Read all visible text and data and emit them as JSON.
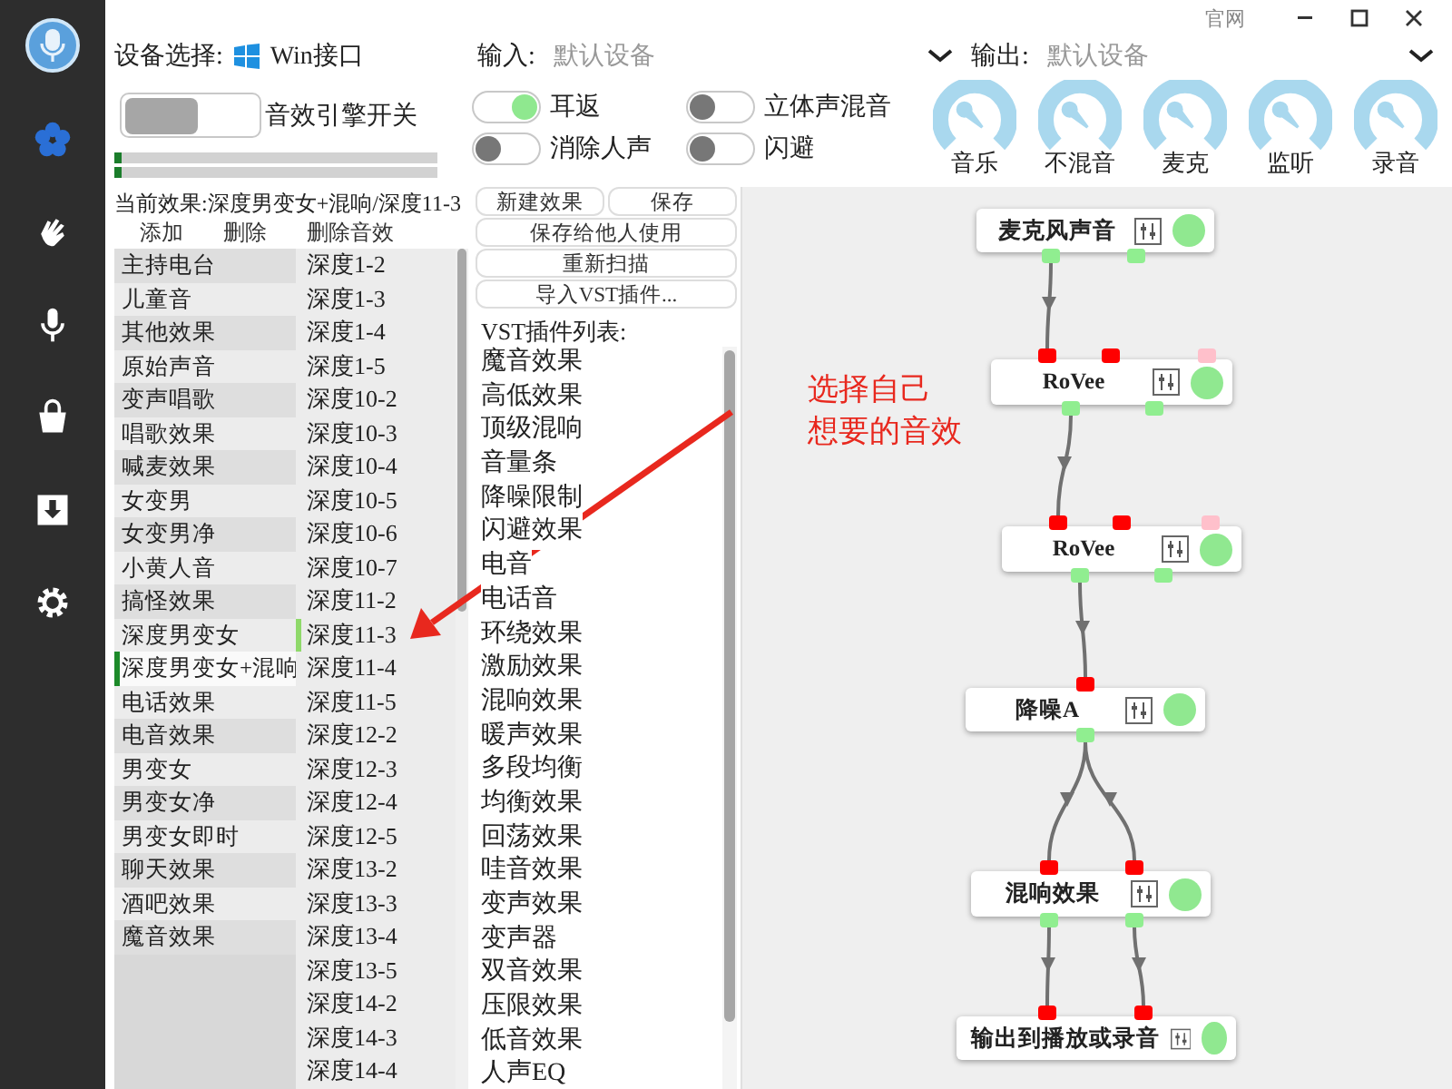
{
  "window": {
    "link": "官网"
  },
  "sidebar": {
    "items": [
      {
        "selected": true
      },
      {
        "selected": false
      },
      {
        "selected": false
      },
      {
        "selected": false
      },
      {
        "selected": false
      },
      {
        "selected": false
      }
    ]
  },
  "device": {
    "label": "设备选择:",
    "value": "Win接口"
  },
  "input": {
    "label": "输入:",
    "value": "默认设备"
  },
  "output": {
    "label": "输出:",
    "value": "默认设备"
  },
  "engine": {
    "label": "音效引擎开关",
    "on": false
  },
  "meters": [
    {
      "level": 0.02
    },
    {
      "level": 0.02
    }
  ],
  "switches": [
    {
      "label": "耳返",
      "on": true
    },
    {
      "label": "立体声混音",
      "on": false
    },
    {
      "label": "消除人声",
      "on": false
    },
    {
      "label": "闪避",
      "on": false
    }
  ],
  "knobs": [
    {
      "label": "音乐"
    },
    {
      "label": "不混音"
    },
    {
      "label": "麦克"
    },
    {
      "label": "监听"
    },
    {
      "label": "录音"
    }
  ],
  "current_effect": "当前效果:深度男变女+混响/深度11-3",
  "actions": [
    "添加",
    "删除",
    "删除音效"
  ],
  "presets": [
    {
      "label": "主持电台",
      "selected": false
    },
    {
      "label": "儿童音",
      "selected": false
    },
    {
      "label": "其他效果",
      "selected": false
    },
    {
      "label": "原始声音",
      "selected": false
    },
    {
      "label": "变声唱歌",
      "selected": false
    },
    {
      "label": "唱歌效果",
      "selected": false
    },
    {
      "label": "喊麦效果",
      "selected": false
    },
    {
      "label": "女变男",
      "selected": false
    },
    {
      "label": "女变男净",
      "selected": false
    },
    {
      "label": "小黄人音",
      "selected": false
    },
    {
      "label": "搞怪效果",
      "selected": false
    },
    {
      "label": "深度男变女",
      "selected": false
    },
    {
      "label": "深度男变女+混响",
      "selected": true
    },
    {
      "label": "电话效果",
      "selected": false
    },
    {
      "label": "电音效果",
      "selected": false
    },
    {
      "label": "男变女",
      "selected": false
    },
    {
      "label": "男变女净",
      "selected": false
    },
    {
      "label": "男变女即时",
      "selected": false
    },
    {
      "label": "聊天效果",
      "selected": false
    },
    {
      "label": "酒吧效果",
      "selected": false
    },
    {
      "label": "魔音效果",
      "selected": false
    }
  ],
  "variants": [
    {
      "label": "深度1-2",
      "selected": false
    },
    {
      "label": "深度1-3",
      "selected": false
    },
    {
      "label": "深度1-4",
      "selected": false
    },
    {
      "label": "深度1-5",
      "selected": false
    },
    {
      "label": "深度10-2",
      "selected": false
    },
    {
      "label": "深度10-3",
      "selected": false
    },
    {
      "label": "深度10-4",
      "selected": false
    },
    {
      "label": "深度10-5",
      "selected": false
    },
    {
      "label": "深度10-6",
      "selected": false
    },
    {
      "label": "深度10-7",
      "selected": false
    },
    {
      "label": "深度11-2",
      "selected": false
    },
    {
      "label": "深度11-3",
      "selected": true
    },
    {
      "label": "深度11-4",
      "selected": false
    },
    {
      "label": "深度11-5",
      "selected": false
    },
    {
      "label": "深度12-2",
      "selected": false
    },
    {
      "label": "深度12-3",
      "selected": false
    },
    {
      "label": "深度12-4",
      "selected": false
    },
    {
      "label": "深度12-5",
      "selected": false
    },
    {
      "label": "深度13-2",
      "selected": false
    },
    {
      "label": "深度13-3",
      "selected": false
    },
    {
      "label": "深度13-4",
      "selected": false
    },
    {
      "label": "深度13-5",
      "selected": false
    },
    {
      "label": "深度14-2",
      "selected": false
    },
    {
      "label": "深度14-3",
      "selected": false
    },
    {
      "label": "深度14-4",
      "selected": false
    }
  ],
  "buttons": [
    [
      "新建效果",
      "保存"
    ],
    [
      "保存给他人使用"
    ],
    [
      "重新扫描"
    ],
    [
      "导入VST插件..."
    ]
  ],
  "vst": {
    "title": "VST插件列表:",
    "items": [
      "魔音效果",
      "高低效果",
      "顶级混响",
      "音量条",
      "降噪限制",
      "闪避效果",
      "电音",
      "电话音",
      "环绕效果",
      "激励效果",
      "混响效果",
      "暖声效果",
      "多段均衡",
      "均衡效果",
      "回荡效果",
      "哇音效果",
      "变声效果",
      "变声器",
      "双音效果",
      "压限效果",
      "低音效果",
      "人声EQ"
    ]
  },
  "graph": {
    "nodes": [
      {
        "title": "麦克风声音",
        "enabled": true,
        "outputs": [
          {
            "color": "#90ee90"
          },
          {
            "color": "#90ee90"
          }
        ]
      },
      {
        "title": "RoVee",
        "enabled": true,
        "inputs": [
          {
            "color": "#ff0000"
          },
          {
            "color": "#ff0000"
          },
          {
            "color": "#ffc0cb"
          }
        ],
        "outputs": [
          {
            "color": "#90ee90"
          },
          {
            "color": "#90ee90"
          }
        ]
      },
      {
        "title": "RoVee",
        "enabled": true,
        "inputs": [
          {
            "color": "#ff0000"
          },
          {
            "color": "#ff0000"
          },
          {
            "color": "#ffc0cb"
          }
        ],
        "outputs": [
          {
            "color": "#90ee90"
          },
          {
            "color": "#90ee90"
          }
        ]
      },
      {
        "title": "降噪A",
        "enabled": true,
        "inputs": [
          {
            "color": "#ff0000"
          }
        ],
        "outputs": [
          {
            "color": "#90ee90"
          }
        ]
      },
      {
        "title": "混响效果",
        "enabled": true,
        "inputs": [
          {
            "color": "#ff0000"
          },
          {
            "color": "#ff0000"
          }
        ],
        "outputs": [
          {
            "color": "#90ee90"
          },
          {
            "color": "#90ee90"
          }
        ]
      },
      {
        "title": "输出到播放或录音",
        "enabled": true,
        "inputs": [
          {
            "color": "#ff0000"
          },
          {
            "color": "#ff0000"
          }
        ]
      }
    ]
  },
  "annotation": {
    "lines": [
      "选择自己",
      "想要的音效"
    ]
  }
}
